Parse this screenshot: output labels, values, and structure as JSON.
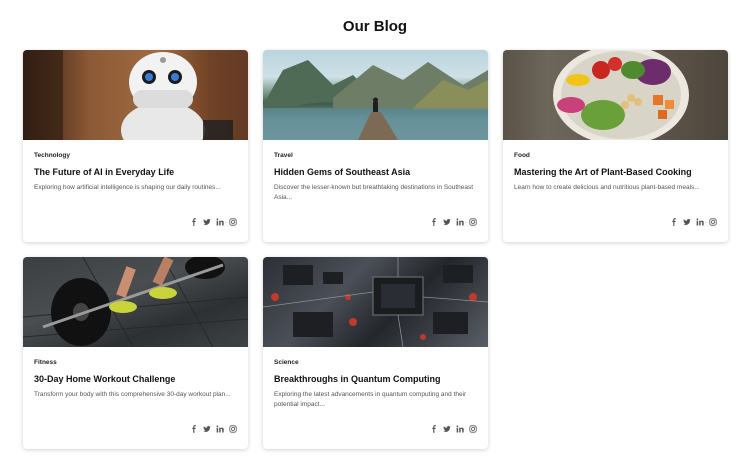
{
  "page": {
    "title": "Our Blog"
  },
  "posts": [
    {
      "category": "Technology",
      "title": "The Future of AI in Everyday Life",
      "excerpt": "Exploring how artificial intelligence is shaping our daily routines..."
    },
    {
      "category": "Travel",
      "title": "Hidden Gems of Southeast Asia",
      "excerpt": "Discover the lesser-known but breathtaking destinations in Southeast Asia..."
    },
    {
      "category": "Food",
      "title": "Mastering the Art of Plant-Based Cooking",
      "excerpt": "Learn how to create delicious and nutritious plant-based meals..."
    },
    {
      "category": "Fitness",
      "title": "30-Day Home Workout Challenge",
      "excerpt": "Transform your body with this comprehensive 30-day workout plan..."
    },
    {
      "category": "Science",
      "title": "Breakthroughs in Quantum Computing",
      "excerpt": "Exploring the latest advancements in quantum computing and their potential impact..."
    }
  ],
  "share_icons": [
    "facebook-icon",
    "twitter-icon",
    "linkedin-icon",
    "instagram-icon"
  ],
  "colors": {
    "icon": "#555555",
    "background": "#ffffff"
  }
}
